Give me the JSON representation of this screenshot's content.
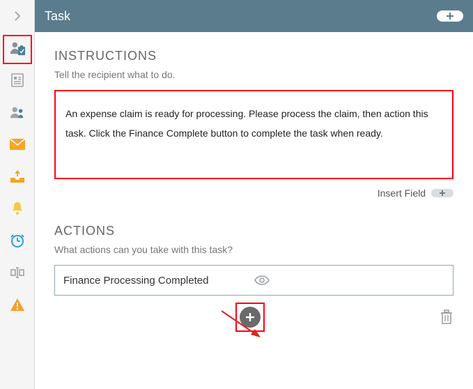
{
  "header": {
    "title": "Task"
  },
  "instructions": {
    "heading": "INSTRUCTIONS",
    "subheading": "Tell the recipient what to do.",
    "text": "An expense claim is ready for processing. Please process the claim, then action this task. Click the Finance Complete button to complete the task when ready.",
    "insert_field_label": "Insert Field"
  },
  "actions": {
    "heading": "ACTIONS",
    "subheading": "What actions can you take with this task?",
    "items": [
      "Finance Processing Completed"
    ]
  },
  "icons": {
    "sidebar": [
      "collapse-chevron",
      "user-task",
      "document",
      "people",
      "mail",
      "inbox-upload",
      "bell",
      "clock",
      "text-cursor",
      "warning"
    ]
  }
}
